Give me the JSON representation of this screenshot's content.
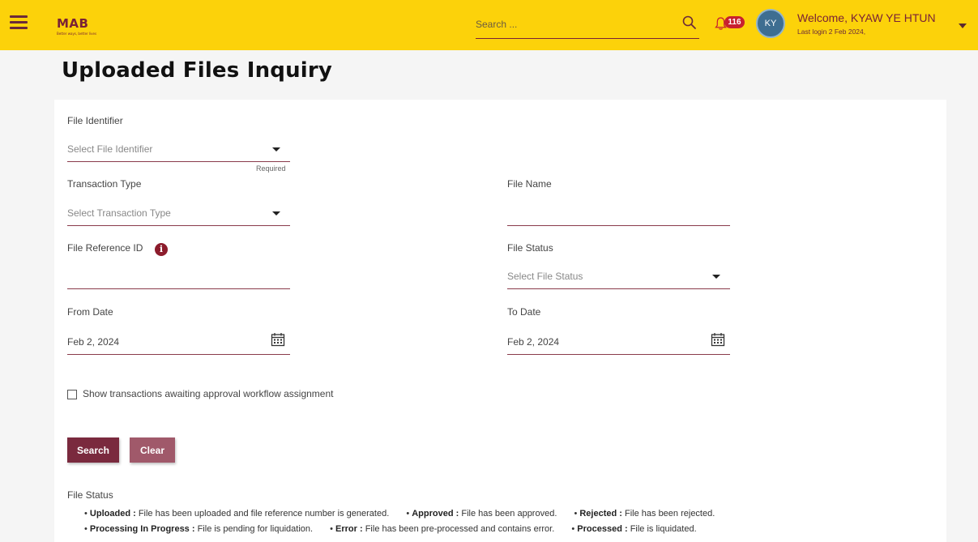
{
  "header": {
    "logo_text": "MAB",
    "logo_tagline": "Better ways, better lives",
    "search_placeholder": "Search ...",
    "notification_count": "116",
    "avatar_initials": "KY",
    "welcome_text": "Welcome, KYAW YE HTUN",
    "last_login": "Last login 2 Feb 2024,"
  },
  "page": {
    "title": "Uploaded Files Inquiry"
  },
  "form": {
    "file_identifier": {
      "label": "File Identifier",
      "placeholder": "Select File Identifier",
      "hint": "Required"
    },
    "transaction_type": {
      "label": "Transaction Type",
      "placeholder": "Select Transaction Type"
    },
    "file_name": {
      "label": "File Name",
      "value": ""
    },
    "file_reference_id": {
      "label": "File Reference ID",
      "value": ""
    },
    "file_status": {
      "label": "File Status",
      "placeholder": "Select File Status"
    },
    "from_date": {
      "label": "From Date",
      "value": "Feb 2, 2024"
    },
    "to_date": {
      "label": "To Date",
      "value": "Feb 2, 2024"
    },
    "awaiting_checkbox": {
      "label": "Show transactions awaiting approval workflow assignment",
      "checked": false
    },
    "search_button": "Search",
    "clear_button": "Clear"
  },
  "legend": {
    "title": "File Status",
    "line1": [
      {
        "term": "Uploaded :",
        "desc": " File has been uploaded and file reference number is generated."
      },
      {
        "term": "Approved :",
        "desc": " File has been approved."
      },
      {
        "term": "Rejected :",
        "desc": " File has been rejected."
      }
    ],
    "line2": [
      {
        "term": "Processing In Progress :",
        "desc": " File is pending for liquidation."
      },
      {
        "term": "Error :",
        "desc": " File has been pre-processed and contains error."
      },
      {
        "term": "Processed :",
        "desc": " File is liquidated."
      }
    ]
  },
  "colors": {
    "topbar": "#fcd20a",
    "brand": "#7a2236",
    "primary_button": "#7a2a3e",
    "secondary_button": "#a0596a",
    "badge": "#c8202f"
  }
}
